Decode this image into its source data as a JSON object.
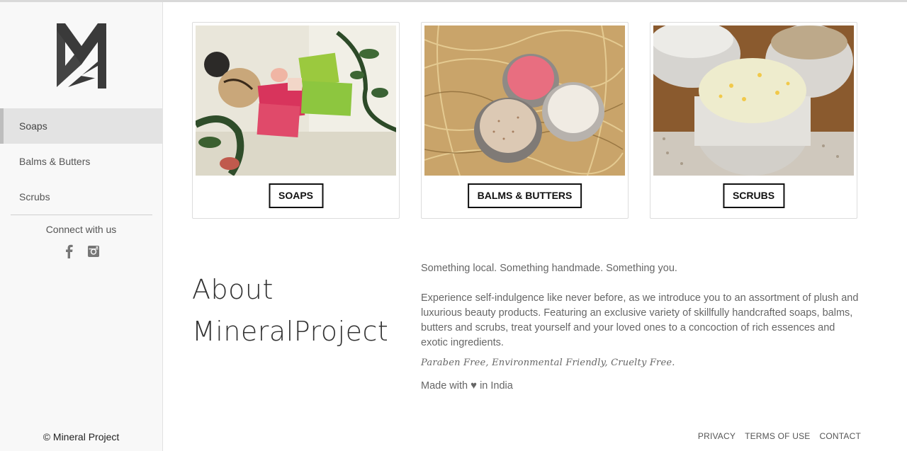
{
  "brand": {
    "logo_icon": "mineral-project-mp-logo"
  },
  "sidebar": {
    "items": [
      {
        "label": "Soaps",
        "active": true
      },
      {
        "label": "Balms & Butters",
        "active": false
      },
      {
        "label": "Scrubs",
        "active": false
      }
    ],
    "connect_label": "Connect with us",
    "social_icons": [
      "facebook-icon",
      "instagram-icon"
    ],
    "copyright": "© Mineral Project"
  },
  "products": [
    {
      "label": "SOAPS",
      "image": "soaps-photo"
    },
    {
      "label": "BALMS & BUTTERS",
      "image": "balms-photo"
    },
    {
      "label": "SCRUBS",
      "image": "scrubs-photo"
    }
  ],
  "about": {
    "title_line1": "About",
    "title_line2": "MineralProject",
    "tagline": "Something local. Something handmade. Something you.",
    "description": "Experience self-indulgence like never before, as we introduce you to an assortment of plush and luxurious beauty products. Featuring an exclusive variety of skillfully handcrafted soaps, balms, butters and scrubs, treat yourself and your loved ones to a concoction of rich essences and exotic ingredients.",
    "features": "Paraben Free, Environmental Friendly, Cruelty Free.",
    "made_prefix": "Made with",
    "made_icon": "heart-icon",
    "made_suffix": "in India"
  },
  "footer": {
    "privacy": "PRIVACY",
    "terms": "TERMS OF USE",
    "contact": "CONTACT"
  },
  "colors": {
    "text": "#555555",
    "sidebar_bg": "#f8f8f8",
    "active_bg": "#e3e3e3",
    "logo": "#3a3a3a"
  }
}
